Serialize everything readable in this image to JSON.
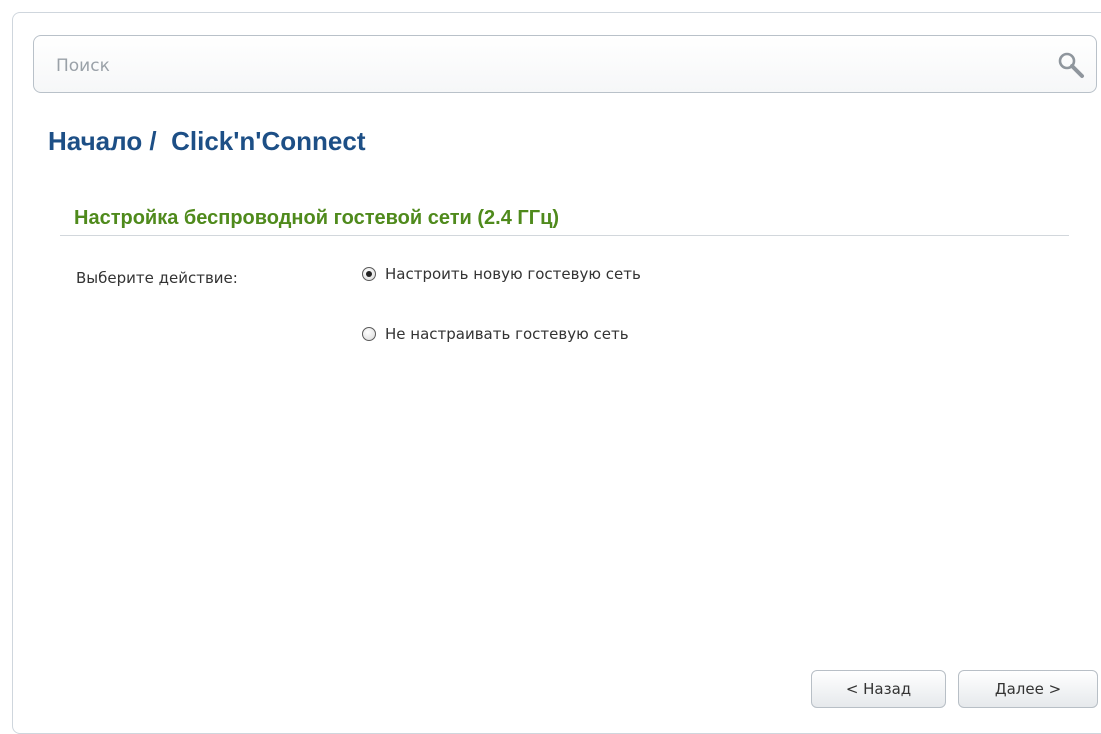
{
  "search": {
    "placeholder": "Поиск",
    "value": ""
  },
  "breadcrumb": {
    "text": "Начало /  Click'n'Connect"
  },
  "section": {
    "title": "Настройка беспроводной гостевой сети (2.4 ГГц)"
  },
  "action": {
    "label": "Выберите действие:",
    "options": [
      {
        "label": "Настроить новую гостевую сеть",
        "checked": true
      },
      {
        "label": "Не настраивать гостевую сеть",
        "checked": false
      }
    ]
  },
  "buttons": {
    "back": "< Назад",
    "next": "Далее >"
  },
  "colors": {
    "breadcrumb": "#1d4f86",
    "section_title": "#4f8a1c"
  }
}
